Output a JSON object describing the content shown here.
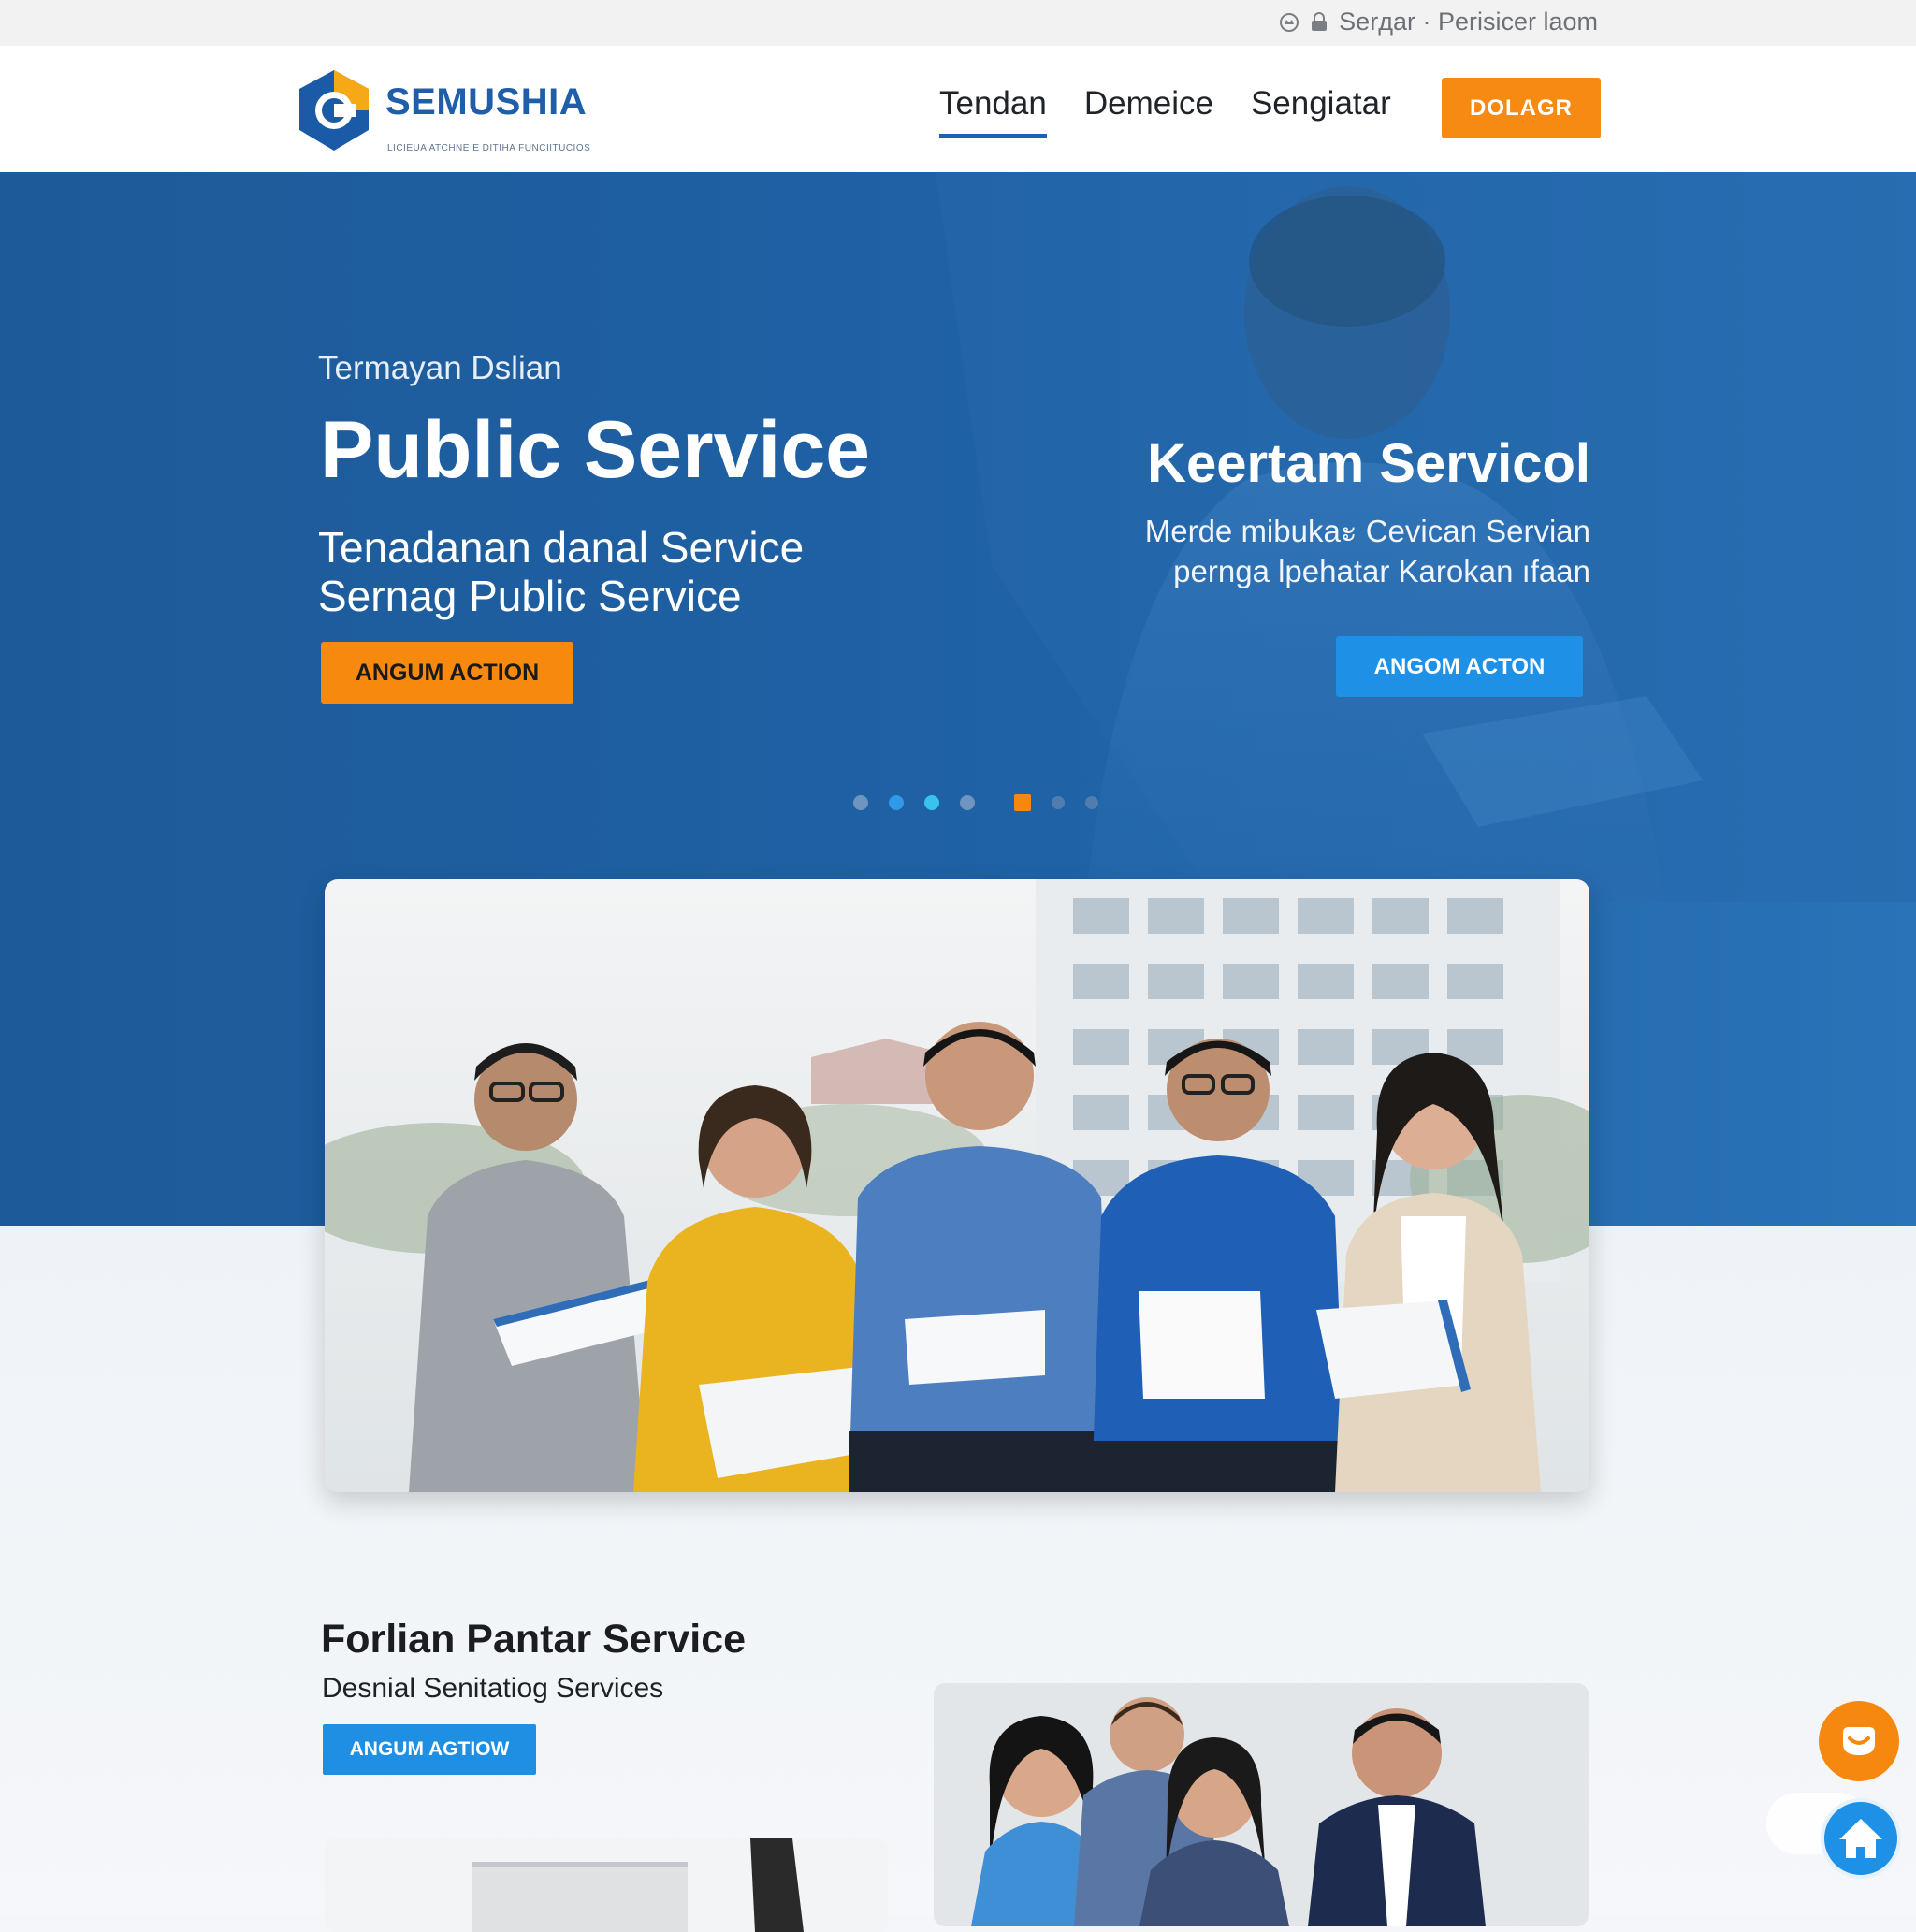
{
  "topbar": {
    "text": "Serдar · Perisicer lаom",
    "icons": [
      "crown-icon",
      "lock-icon"
    ]
  },
  "nav": {
    "logo_name": "SEMUSHIA",
    "logo_tagline": "LICIEUA ATCHNE E DITIHA FUNCIITUCIOS",
    "links": [
      {
        "label": "Tendan",
        "active": true
      },
      {
        "label": "Demeice",
        "active": false
      },
      {
        "label": "Sengiatar",
        "active": false
      }
    ],
    "cta_label": "DOLAGR"
  },
  "hero": {
    "eyebrow": "Termayan Dslian",
    "title": "Public Service",
    "subtitle_line1": "Tenadanan danal Service",
    "subtitle_line2": "Sernag Public Service",
    "primary_button": "ANGUM ACTION",
    "right_title": "Keertam Servicol",
    "right_text_line1": "Merde mibukaะ Cevican Servian",
    "right_text_line2": "pernga lpehatar Karokan ıfaan",
    "right_button": "ANGOM ACTON",
    "carousel": {
      "count": 7,
      "active_index": 4
    }
  },
  "section": {
    "title": "Forlian Pantar Service",
    "subtitle": "Desnial Senitatiog Services",
    "button": "ANGUM AGTIOW"
  },
  "colors": {
    "brand_blue": "#1f5ea8",
    "hero_blue": "#1d5a99",
    "accent_orange": "#f78a12",
    "button_blue": "#1e90e6"
  },
  "floating": {
    "chat_icon": "chat-smile-icon",
    "home_icon": "home-icon"
  }
}
